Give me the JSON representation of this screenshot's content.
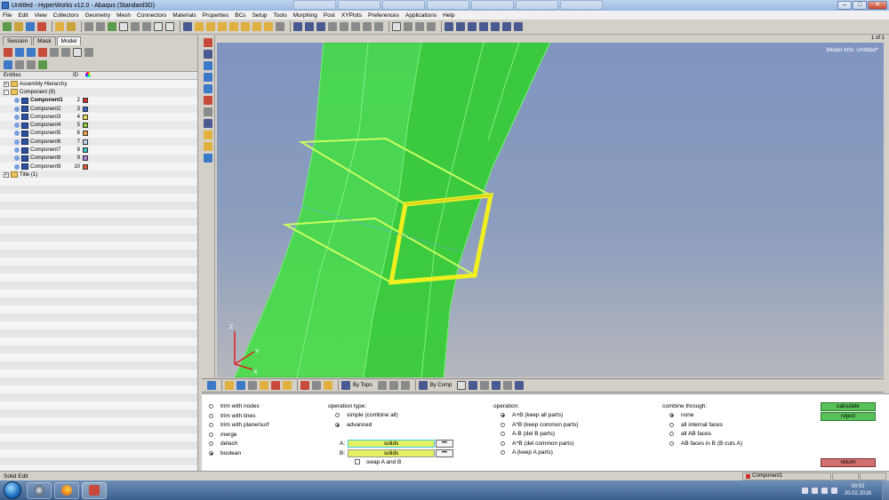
{
  "window": {
    "title": "Untitled - HyperWorks v12.0 - Abaqus (Standard3D)",
    "controls": {
      "minimize": "–",
      "maximize": "□",
      "close": "✕"
    }
  },
  "menu": [
    "File",
    "Edit",
    "View",
    "Collectors",
    "Geometry",
    "Mesh",
    "Connectors",
    "Materials",
    "Properties",
    "BCs",
    "Setup",
    "Tools",
    "Morphing",
    "Post",
    "XYPlots",
    "Preferences",
    "Applications",
    "Help"
  ],
  "browser": {
    "tabs": [
      "Session",
      "Mask",
      "Model"
    ],
    "active_tab": "Model",
    "columns": {
      "entities": "Entities",
      "id": "ID"
    },
    "rows": [
      {
        "label": "Assembly Hierarchy",
        "id": "",
        "color": "",
        "indent": 0,
        "type": "folder",
        "expand": "+"
      },
      {
        "label": "Component (9)",
        "id": "",
        "color": "",
        "indent": 0,
        "type": "folder",
        "expand": "-"
      },
      {
        "label": "Component1",
        "id": "2",
        "color": "#d03030",
        "indent": 2,
        "type": "comp",
        "bold": true
      },
      {
        "label": "Component2",
        "id": "3",
        "color": "#3060d0",
        "indent": 2,
        "type": "comp"
      },
      {
        "label": "Component3",
        "id": "4",
        "color": "#e8e050",
        "indent": 2,
        "type": "comp"
      },
      {
        "label": "Component4",
        "id": "5",
        "color": "#80d030",
        "indent": 2,
        "type": "comp"
      },
      {
        "label": "Component5",
        "id": "6",
        "color": "#e8a040",
        "indent": 2,
        "type": "comp"
      },
      {
        "label": "Component6",
        "id": "7",
        "color": "#c0d8f0",
        "indent": 2,
        "type": "comp"
      },
      {
        "label": "Component7",
        "id": "8",
        "color": "#40c0c0",
        "indent": 2,
        "type": "comp"
      },
      {
        "label": "Component8",
        "id": "9",
        "color": "#b080d0",
        "indent": 2,
        "type": "comp"
      },
      {
        "label": "Component9",
        "id": "10",
        "color": "#e06040",
        "indent": 2,
        "type": "comp"
      },
      {
        "label": "Title (1)",
        "id": "",
        "color": "",
        "indent": 0,
        "type": "folder",
        "expand": "+"
      }
    ]
  },
  "viewport": {
    "model_info": "Model Info: Untitled*",
    "page_indicator": "1 of 1",
    "triad": {
      "x": "X",
      "y": "Y",
      "z": "Z"
    }
  },
  "view_toolbar": {
    "by_topo": "By Topo",
    "by_comp": "By Comp"
  },
  "panel": {
    "left_options": [
      {
        "label": "trim with nodes",
        "checked": false
      },
      {
        "label": "trim with lines",
        "checked": false
      },
      {
        "label": "trim with plane/surf",
        "checked": false
      },
      {
        "label": "merge",
        "checked": false
      },
      {
        "label": "detach",
        "checked": false
      },
      {
        "label": "boolean",
        "checked": true
      }
    ],
    "operation_type": {
      "header": "operation type:",
      "options": [
        {
          "label": "simple (combine all)",
          "checked": false
        },
        {
          "label": "advanced",
          "checked": true
        }
      ]
    },
    "selectors": {
      "a_label": "A:",
      "a_value": "solids",
      "b_label": "B:",
      "b_value": "solids",
      "reset_glyph": "⏮",
      "swap_label": "swap A and B"
    },
    "operation": {
      "header": "operation:",
      "options": [
        {
          "label": "A+B (keep all parts)",
          "checked": true
        },
        {
          "label": "A*B (keep common parts)",
          "checked": false
        },
        {
          "label": "A-B (del B parts)",
          "checked": false
        },
        {
          "label": "A^B (del common parts)",
          "checked": false
        },
        {
          "label": "A  (keep A parts)",
          "checked": false
        }
      ]
    },
    "combine_through": {
      "header": "combine through:",
      "options": [
        {
          "label": "none",
          "checked": true
        },
        {
          "label": "all internal faces",
          "checked": false
        },
        {
          "label": "all AB faces",
          "checked": false
        },
        {
          "label": "AB faces in B (B cuts A)",
          "checked": false
        }
      ]
    },
    "buttons": {
      "calculate": "calculate",
      "reject": "reject",
      "return": "return"
    }
  },
  "status": {
    "text": "Solid Edit",
    "component": "Component1",
    "component_color": "#c83030"
  },
  "taskbar": {
    "time": "00:02",
    "date": "20.02.2016"
  },
  "colors": {
    "solid_fill": "#3fe03f",
    "highlight": "#f0f020",
    "viewport_top": "#7f95c0"
  }
}
